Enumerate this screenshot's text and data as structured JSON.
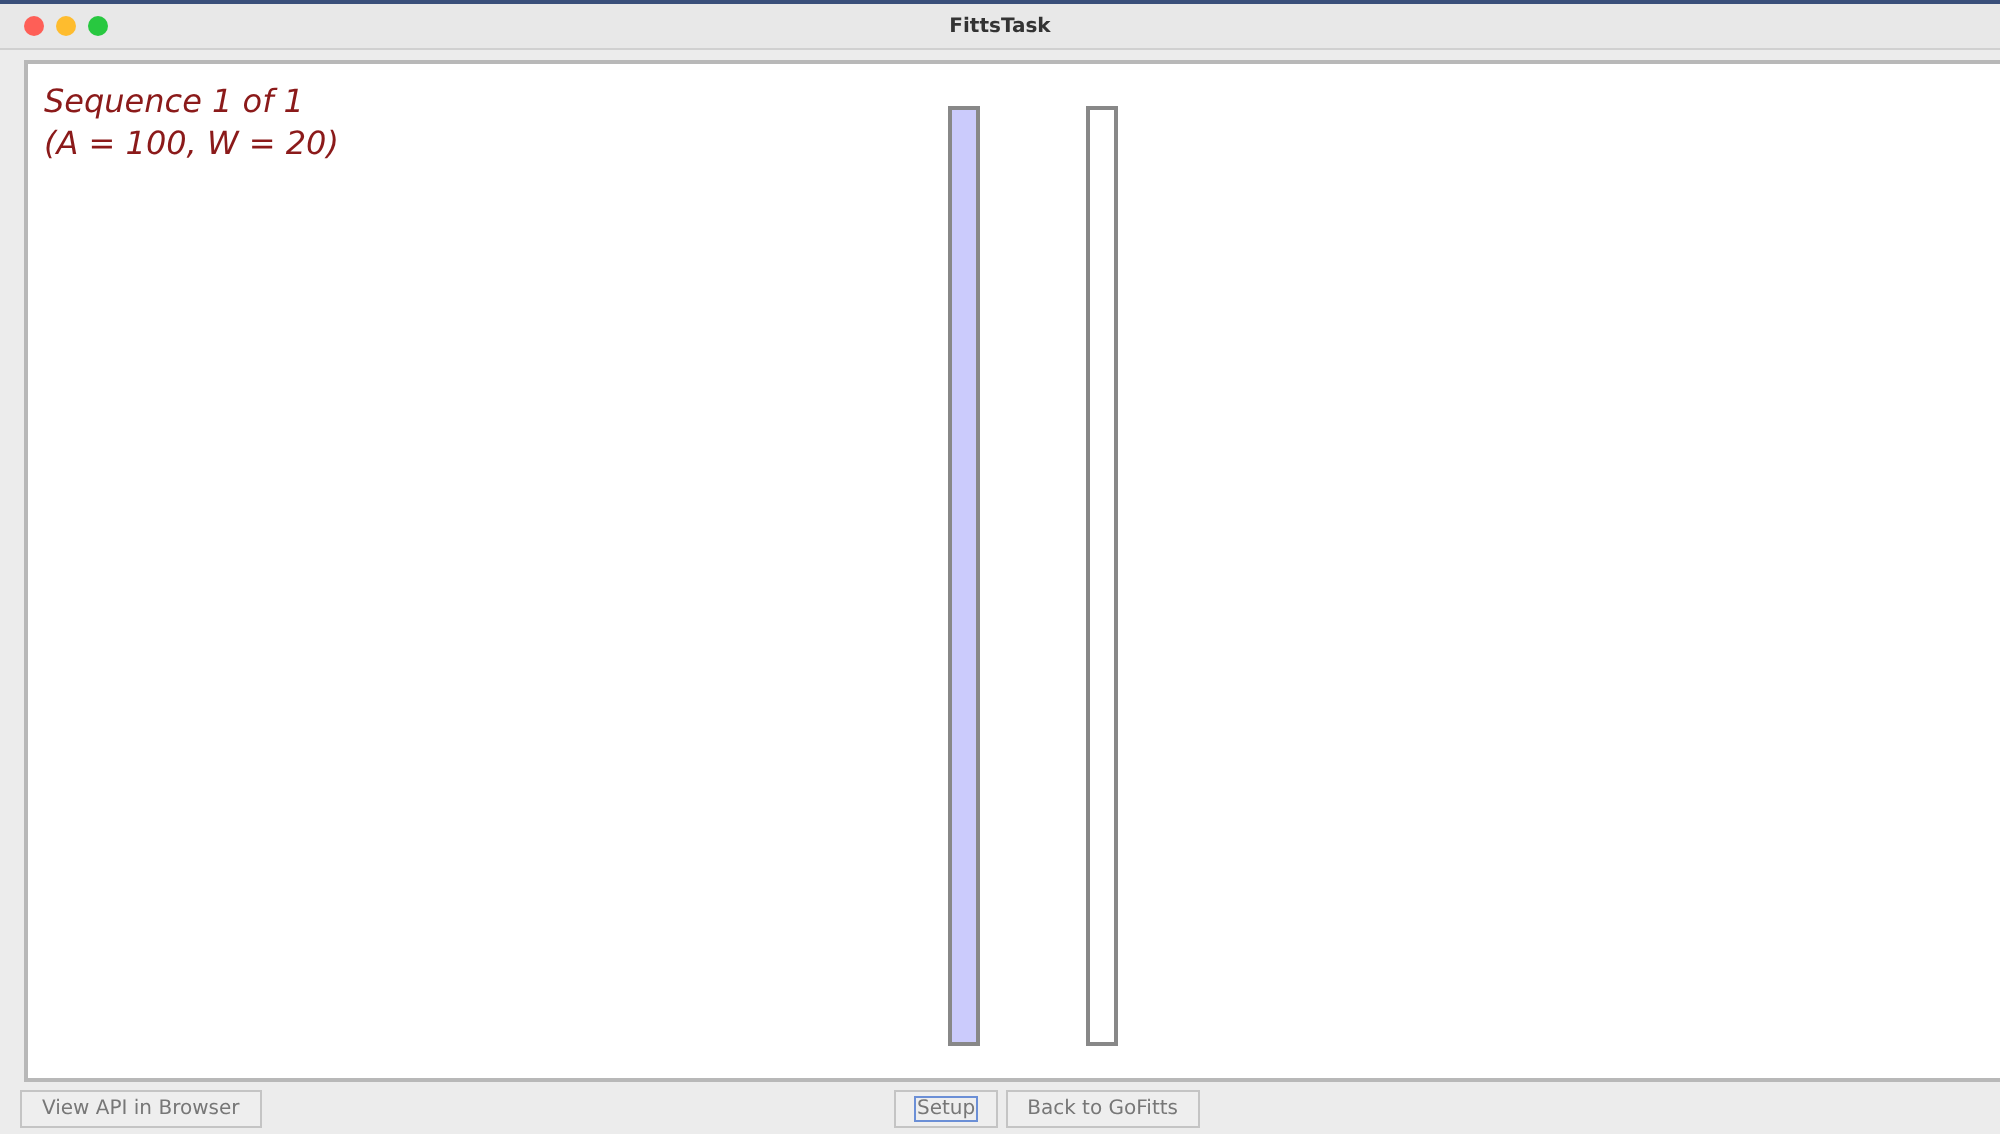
{
  "window": {
    "title": "FittsTask"
  },
  "info_lines": [
    "Sequence 1 of 1",
    "(A = 100, W = 20)"
  ],
  "targets": [
    {
      "highlighted": true
    },
    {
      "highlighted": false
    }
  ],
  "left_buttons": [
    {
      "label": "View API in Browser",
      "focused": false
    }
  ],
  "right_buttons": [
    {
      "label": "Setup",
      "focused": true
    },
    {
      "label": "Back to GoFitts",
      "focused": false
    }
  ]
}
